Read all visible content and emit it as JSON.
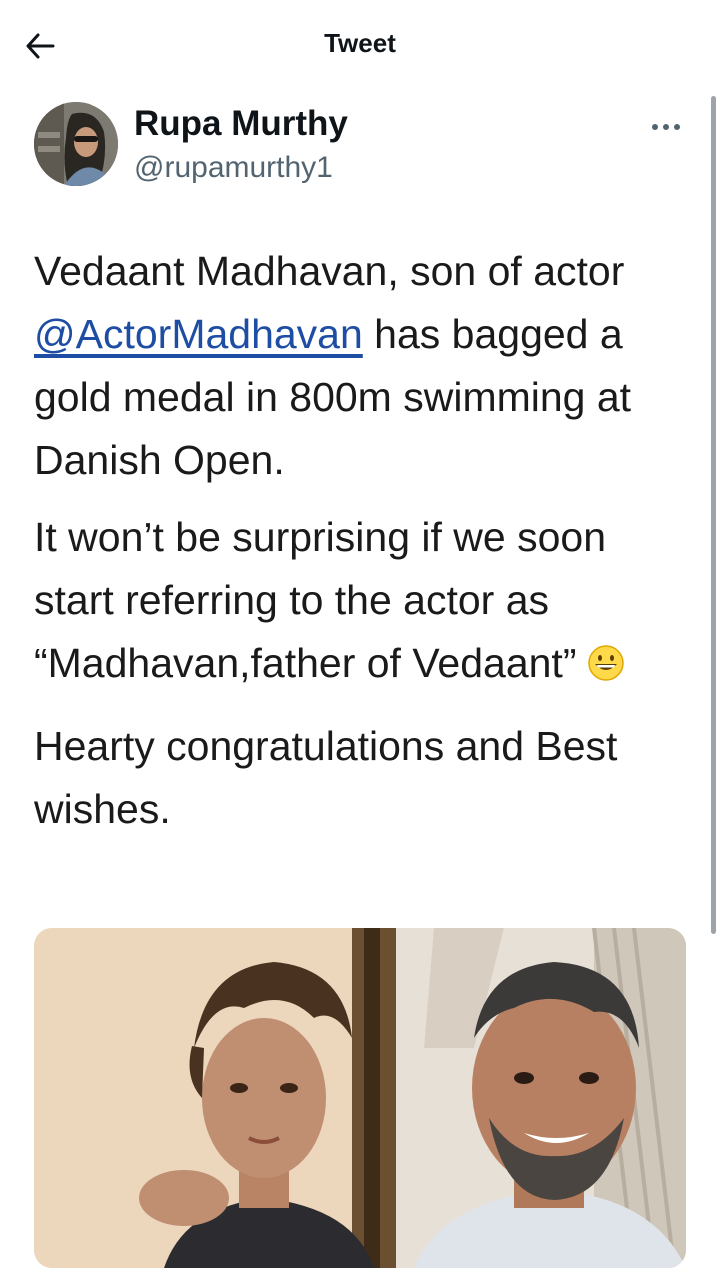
{
  "header": {
    "title": "Tweet",
    "back_icon": "arrow-left-icon"
  },
  "tweet": {
    "author": {
      "display_name": "Rupa Murthy",
      "handle": "@rupamurthy1"
    },
    "more_icon": "more-horizontal-icon",
    "paragraphs": {
      "p1": {
        "before": "Vedaant Madhavan, son of actor ",
        "mention": "@ActorMadhavan",
        "after": " has bagged a gold medal in 800m swimming at Danish Open."
      },
      "p2": {
        "text": "It won’t be surprising if we soon start referring to the actor as “Madhavan,father of Vedaant”",
        "emoji": "grinning-face-emoji"
      },
      "p3": {
        "text": "Hearty congratulations and Best wishes."
      }
    },
    "media": {
      "type": "photo"
    }
  },
  "colors": {
    "mention": "#1d4ea3",
    "handle": "#536471",
    "text": "#0f1419"
  }
}
